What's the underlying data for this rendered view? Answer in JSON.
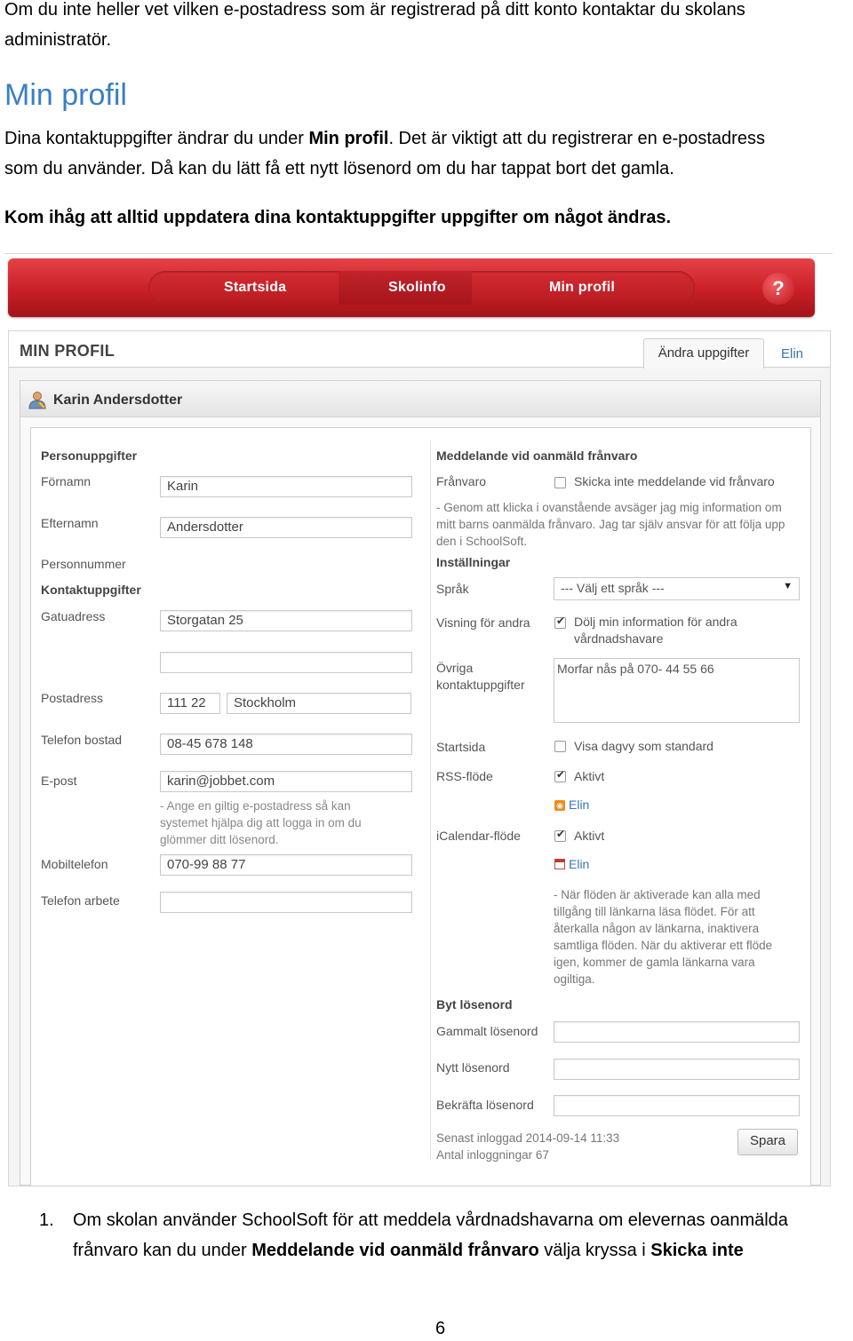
{
  "intro": {
    "line1": "Om du inte heller vet vilken e-postadress som är registrerad på ditt konto kontaktar du skolans",
    "line2": "administratör."
  },
  "heading": "Min profil",
  "para1": {
    "a": "Dina kontaktuppgifter ändrar du under ",
    "b": "Min profil",
    "c": ". Det är viktigt att du registrerar en e-postadress",
    "line2": "som du använder. Då kan du lätt få ett nytt lösenord om du har tappat bort det gamla."
  },
  "bold_note": "Kom ihåg att alltid uppdatera dina kontaktuppgifter uppgifter om något ändras.",
  "nav": {
    "items": [
      "Startsida",
      "Skolinfo",
      "Min profil"
    ],
    "help": "?"
  },
  "panel": {
    "title": "MIN PROFIL",
    "tab_active": "Ändra uppgifter",
    "tab_link": "Elin"
  },
  "card": {
    "title": "Karin Andersdotter"
  },
  "left": {
    "section_personal": "Personuppgifter",
    "fornamn_label": "Förnamn",
    "fornamn_value": "Karin",
    "efternamn_label": "Efternamn",
    "efternamn_value": "Andersdotter",
    "personnummer_label": "Personnummer",
    "section_contact": "Kontaktuppgifter",
    "gatuadress_label": "Gatuadress",
    "gatuadress_value": "Storgatan 25",
    "gatuadress2_value": "",
    "postadress_label": "Postadress",
    "postnummer_value": "111 22",
    "ort_value": "Stockholm",
    "telefon_bostad_label": "Telefon bostad",
    "telefon_bostad_value": "08-45 678 148",
    "epost_label": "E-post",
    "epost_value": "karin@jobbet.com",
    "epost_hint": "- Ange en giltig e-postadress så kan systemet hjälpa dig att logga in om du glömmer ditt lösenord.",
    "mobil_label": "Mobiltelefon",
    "mobil_value": "070-99 88 77",
    "telefon_arbete_label": "Telefon arbete",
    "telefon_arbete_value": ""
  },
  "right": {
    "section_absence": "Meddelande vid oanmäld frånvaro",
    "franvaro_label": "Frånvaro",
    "franvaro_checkbox": "Skicka inte meddelande vid frånvaro",
    "franvaro_checked": false,
    "franvaro_hint": "- Genom att klicka i ovanstående avsäger jag mig information om mitt barns oanmälda frånvaro. Jag tar själv ansvar för att följa upp den i SchoolSoft.",
    "section_settings": "Inställningar",
    "sprak_label": "Språk",
    "sprak_value": "--- Välj ett språk ---",
    "visning_label": "Visning för andra",
    "visning_checkbox_l1": "Dölj min information för andra",
    "visning_checkbox_l2": "vårdnadshavare",
    "visning_checked": true,
    "ovriga_label_l1": "Övriga",
    "ovriga_label_l2": "kontaktuppgifter",
    "ovriga_value": "Morfar nås på  070- 44 55 66",
    "startsida_label": "Startsida",
    "startsida_checkbox": "Visa dagvy som standard",
    "startsida_checked": false,
    "rss_label": "RSS-flöde",
    "rss_checkbox": "Aktivt",
    "rss_checked": true,
    "rss_link": "Elin",
    "ical_label": "iCalendar-flöde",
    "ical_checkbox": "Aktivt",
    "ical_checked": true,
    "ical_link": "Elin",
    "feed_hint": "- När flöden är aktiverade kan alla med tillgång till länkarna läsa flödet. För att återkalla någon av länkarna, inaktivera samtliga flöden. När du aktiverar ett flöde igen, kommer de gamla länkarna vara ogiltiga.",
    "section_password": "Byt lösenord",
    "gammalt_label": "Gammalt lösenord",
    "nytt_label": "Nytt lösenord",
    "bekrafta_label": "Bekräfta lösenord",
    "last_login": "Senast inloggad 2014-09-14 11:33",
    "login_count": "Antal inloggningar 67",
    "save_label": "Spara"
  },
  "list_item": {
    "number": "1.",
    "a": "Om skolan använder SchoolSoft för att meddela vårdnadshavarna om elevernas oanmälda frånvaro kan du under ",
    "b": "Meddelande vid oanmäld frånvaro",
    "c": " välja kryssa i ",
    "d": "Skicka inte"
  },
  "page_number": "6"
}
